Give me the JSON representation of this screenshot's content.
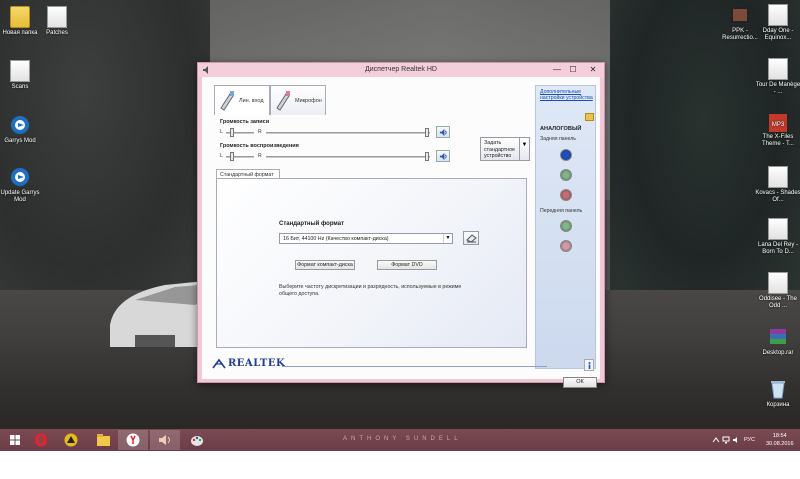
{
  "desktop": {
    "left_icons": [
      {
        "label": "Новая папка",
        "icon": "folder-icon"
      },
      {
        "label": "Patches",
        "icon": "folder-doc-icon"
      },
      {
        "label": "Scans",
        "icon": "folder-icon"
      },
      {
        "label": "Garrys Mod",
        "icon": "gmod-icon"
      },
      {
        "label": "Update Garrys Mod",
        "icon": "gmod-icon"
      }
    ],
    "right_icons": [
      {
        "label": "PPK - Resurrectio...",
        "icon": "video-icon"
      },
      {
        "label": "Dday One - Equinox...",
        "icon": "folder-icon"
      },
      {
        "label": "Tour De Manège - ...",
        "icon": "folder-icon"
      },
      {
        "label": "MP3",
        "icon": "mp3-icon"
      },
      {
        "label": "The X-Files Theme - T...",
        "icon": "folder-icon"
      },
      {
        "label": "Kovacs - Shades Of...",
        "icon": "folder-icon"
      },
      {
        "label": "Lana Del Rey - Born To D...",
        "icon": "folder-icon"
      },
      {
        "label": "Oddisee - The Odd ...",
        "icon": "folder-icon"
      },
      {
        "label": "Desktop.rar",
        "icon": "winrar-icon"
      },
      {
        "label": "Корзина",
        "icon": "recycle-bin-icon"
      }
    ]
  },
  "window": {
    "title": "Диспетчер Realtek HD",
    "controls": {
      "minimize": "—",
      "maximize": "☐",
      "close": "✕"
    },
    "tabs": [
      {
        "label": "Лин. вход",
        "active": true
      },
      {
        "label": "Микрофон",
        "active": false
      }
    ],
    "record_volume_label": "Громкость записи",
    "playback_volume_label": "Громкость воспроизведения",
    "left_letter": "L",
    "right_letter": "R",
    "default_device_button": "Задать стандартное устройство",
    "format_tab_label": "Стандартный формат",
    "format_heading": "Стандартный формат",
    "format_value": "16 Бит, 44100 Hz (Качество компакт-диска)",
    "cd_format_button": "Формат компакт-диска",
    "dvd_format_button": "Формат DVD",
    "format_description": "Выберите частоту дискретизации и разрядность, используемые в режиме общего доступа.",
    "advanced_link": "Дополнительные настройки устройства",
    "analog_heading": "АНАЛОГОВЫЙ",
    "back_panel_label": "Задняя панель",
    "front_panel_label": "Передняя панель",
    "jack_colors": {
      "back": [
        "#1f4fbf",
        "#7fb58a",
        "#c46c78"
      ],
      "front": [
        "#7fb58a",
        "#d29aa6"
      ]
    },
    "logo_text": "REALTEK",
    "ok_button": "ОК"
  },
  "taskbar": {
    "brand": "ANTHONY SUNDELL",
    "apps": [
      "start-icon",
      "opera-icon",
      "app-triangle-icon",
      "explorer-icon",
      "yandex-icon",
      "speaker-app-icon",
      "paint-icon"
    ],
    "language": "РУС",
    "time": "18:54",
    "date": "30.08.2016"
  }
}
